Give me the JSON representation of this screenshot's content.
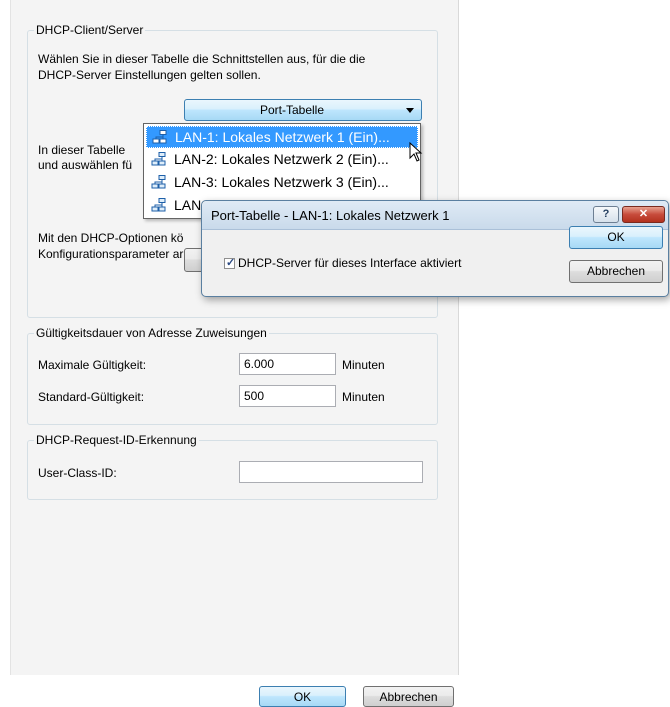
{
  "dhcp": {
    "legend": "DHCP-Client/Server",
    "desc1": "Wählen Sie in dieser Tabelle die Schnittstellen aus, für die die",
    "desc2": "DHCP-Server Einstellungen gelten sollen.",
    "port_table_label": "Port-Tabelle",
    "text2_line1": "In dieser Tabelle",
    "text2_line2": "und auswählen fü",
    "text3_line1": "Mit den DHCP-Optionen kö",
    "text3_line2": "Konfigurationsparameter ar"
  },
  "dropdown": {
    "items": [
      {
        "label": "LAN-1: Lokales Netzwerk 1 (Ein)..."
      },
      {
        "label": "LAN-2: Lokales Netzwerk 2 (Ein)..."
      },
      {
        "label": "LAN-3: Lokales Netzwerk 3 (Ein)..."
      },
      {
        "label": "LAN"
      }
    ],
    "selected_index": 0
  },
  "validity": {
    "legend": "Gültigkeitsdauer von Adresse Zuweisungen",
    "max_label": "Maximale Gültigkeit:",
    "max_value": "6.000",
    "max_unit": "Minuten",
    "std_label": "Standard-Gültigkeit:",
    "std_value": "500",
    "std_unit": "Minuten"
  },
  "request": {
    "legend": "DHCP-Request-ID-Erkennung",
    "userclass_label": "User-Class-ID:",
    "userclass_value": ""
  },
  "footer": {
    "ok_label": "OK",
    "cancel_label": "Abbrechen"
  },
  "dialog": {
    "title": "Port-Tabelle - LAN-1: Lokales Netzwerk 1",
    "help_glyph": "?",
    "close_glyph": "✕",
    "checkbox_label": "DHCP-Server für dieses Interface aktiviert",
    "checkbox_checked": true,
    "ok_label": "OK",
    "cancel_label": "Abbrechen"
  },
  "colors": {
    "selection": "#3399ff",
    "close_button": "#c74b3b",
    "accent_button": "#a7d9f5"
  }
}
